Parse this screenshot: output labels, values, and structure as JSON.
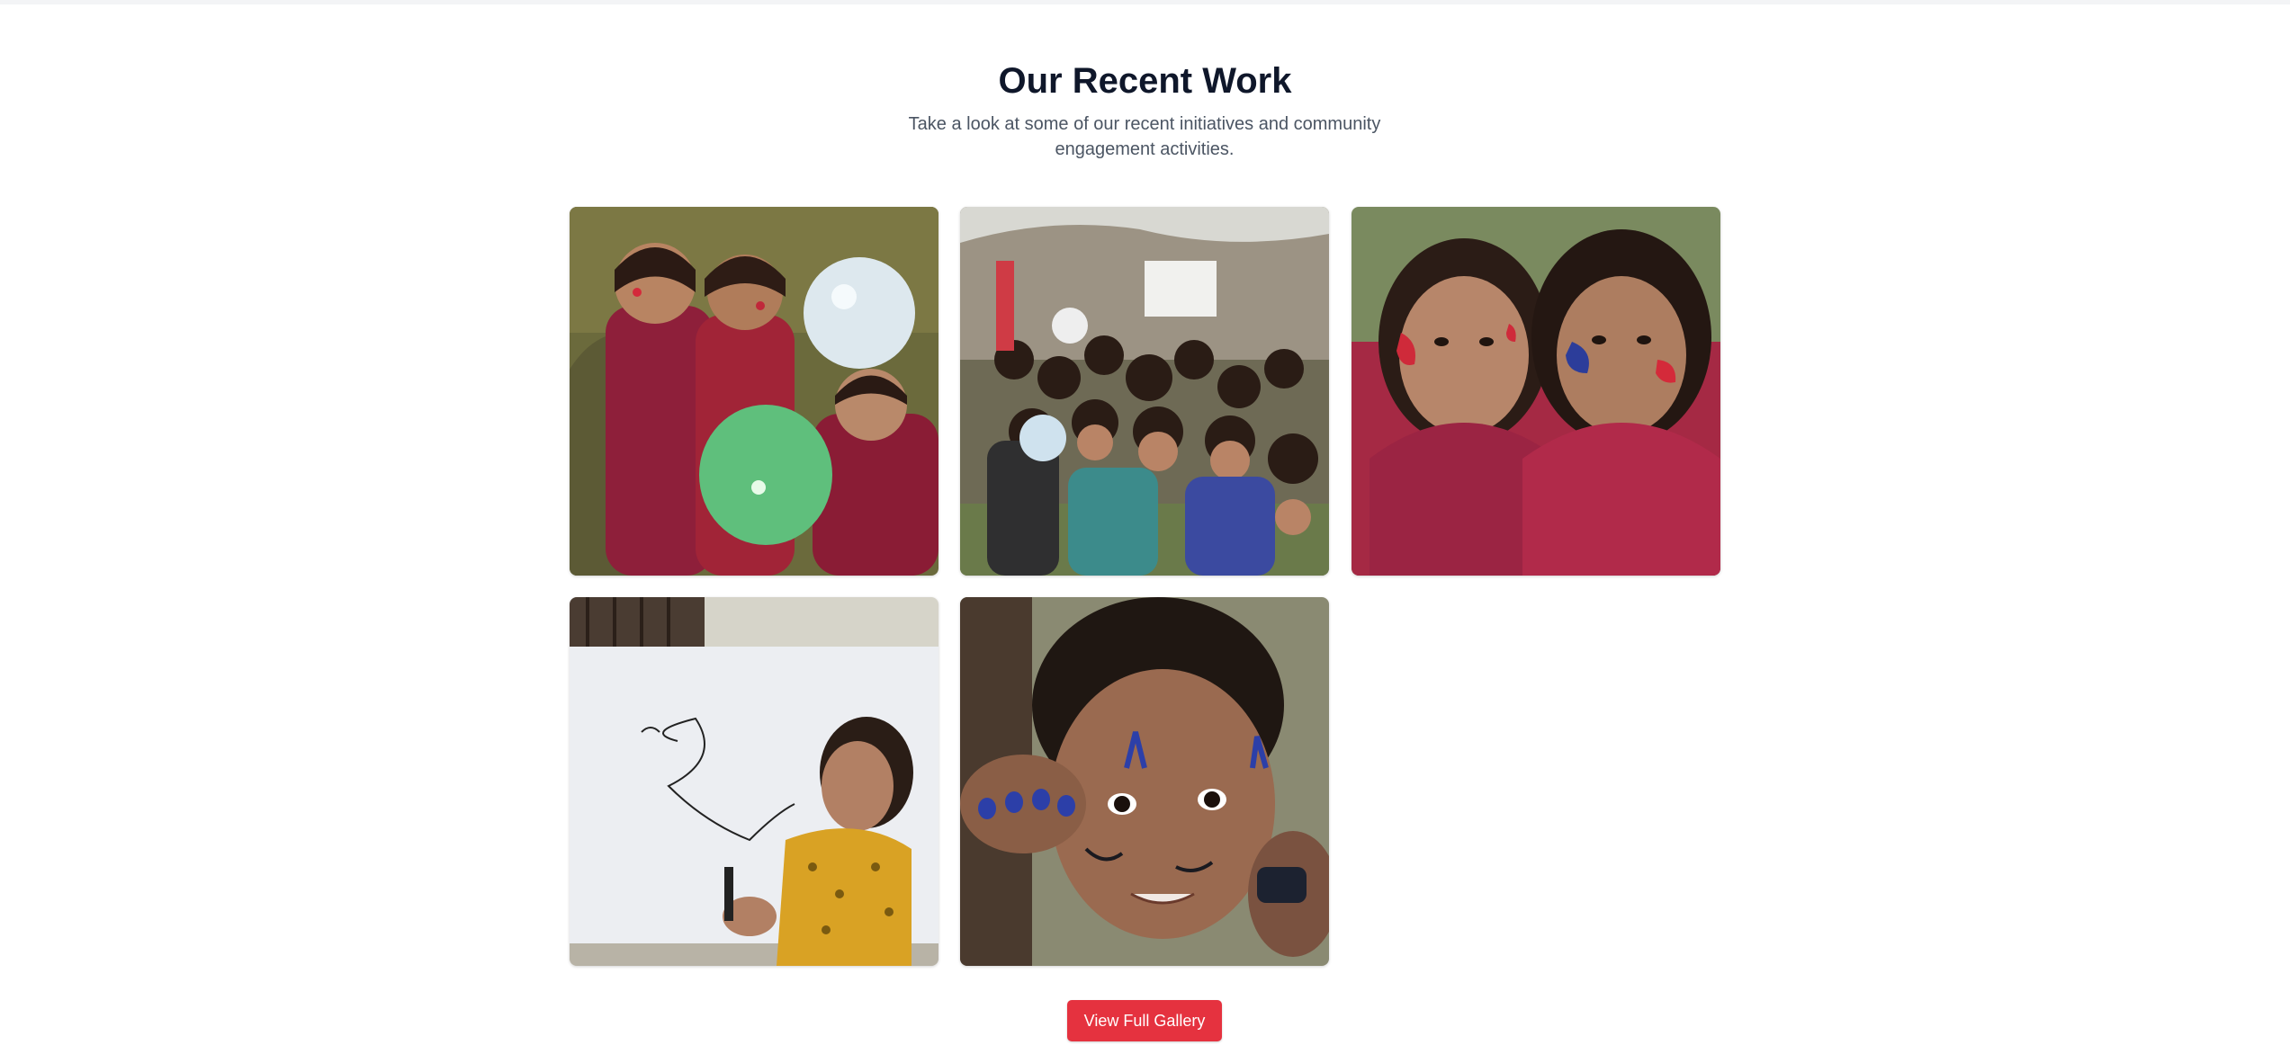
{
  "section": {
    "title": "Our Recent Work",
    "subtitle": "Take a look at some of our recent initiatives and community engagement activities."
  },
  "gallery": {
    "items": [
      {
        "name": "photo-girls-with-balloons"
      },
      {
        "name": "photo-children-group-outdoors"
      },
      {
        "name": "photo-two-girls-face-paint"
      },
      {
        "name": "photo-girl-at-whiteboard"
      },
      {
        "name": "photo-boy-face-paint"
      }
    ]
  },
  "actions": {
    "view_gallery_label": "View Full Gallery"
  },
  "colors": {
    "accent": "#e5323f",
    "title": "#0f172a",
    "subtitle": "#4b5563"
  }
}
